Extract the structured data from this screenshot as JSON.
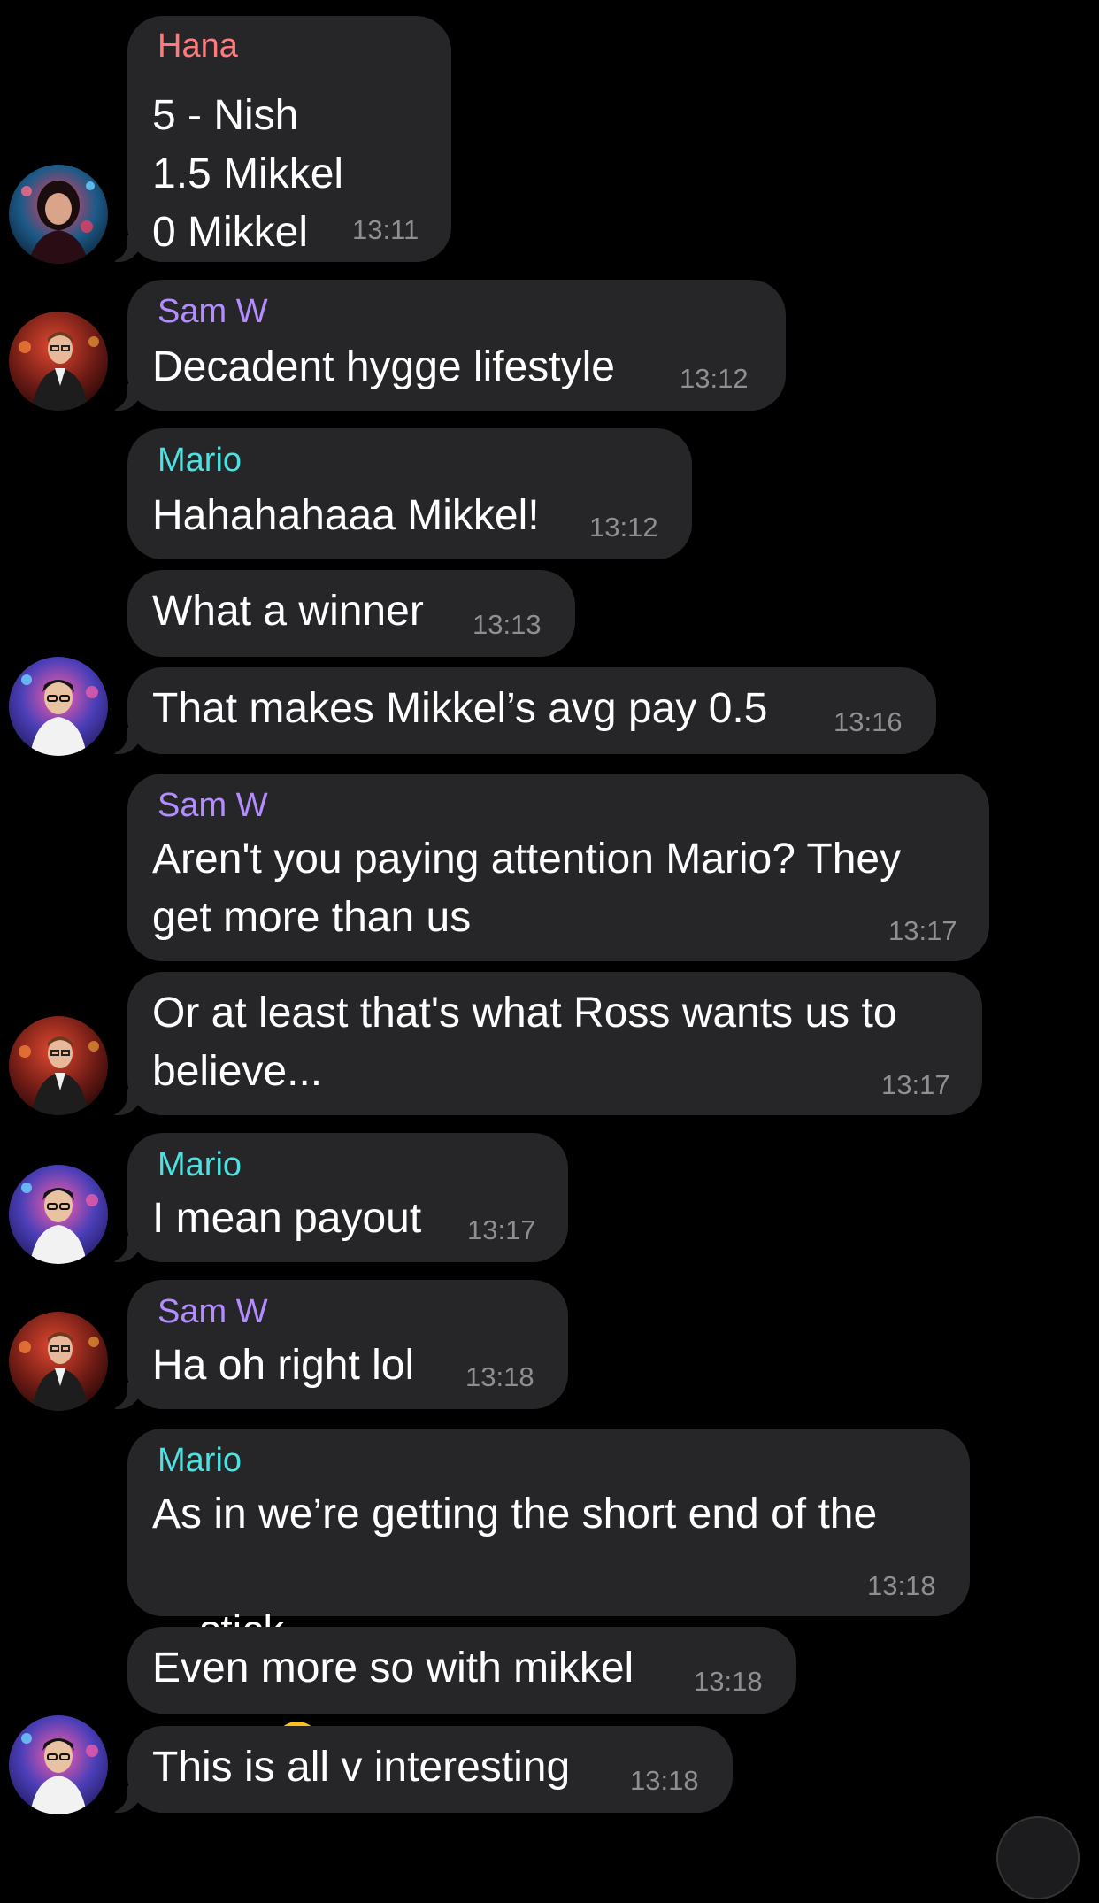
{
  "colors": {
    "background": "#000000",
    "bubble": "#262628",
    "timestamp": "#8e8e93",
    "sender_hana": "#ff7a7a",
    "sender_sam": "#b38cff",
    "sender_mario": "#4fe0e0"
  },
  "messages": [
    {
      "sender": "Hana",
      "lines": [
        "5 - Nish",
        "1.5 Mikkel",
        "0 Mikkel"
      ],
      "time": "13:11"
    },
    {
      "sender": "Sam W",
      "lines": [
        "Decadent hygge lifestyle"
      ],
      "time": "13:12"
    },
    {
      "sender": "Mario",
      "lines": [
        "Hahahahaaa Mikkel!"
      ],
      "time": "13:12"
    },
    {
      "sender": "",
      "lines": [
        "What a winner"
      ],
      "time": "13:13"
    },
    {
      "sender": "",
      "lines": [
        "That makes Mikkel’s avg pay 0.5"
      ],
      "time": "13:16"
    },
    {
      "sender": "Sam W",
      "lines": [
        "Aren't you paying attention Mario? They",
        "get more than us"
      ],
      "time": "13:17"
    },
    {
      "sender": "",
      "lines": [
        "Or at least that's what Ross wants us to",
        "believe..."
      ],
      "time": "13:17"
    },
    {
      "sender": "Mario",
      "lines": [
        "I mean payout"
      ],
      "time": "13:17"
    },
    {
      "sender": "Sam W",
      "lines": [
        "Ha oh right lol"
      ],
      "time": "13:18"
    },
    {
      "sender": "Mario",
      "lines": [
        "As in we’re getting the short end of the",
        "stick"
      ],
      "emoji": "tears-of-joy-emoji",
      "time": "13:18"
    },
    {
      "sender": "",
      "lines": [
        "Even more so with mikkel"
      ],
      "time": "13:18"
    },
    {
      "sender": "",
      "lines": [
        "This is all v interesting"
      ],
      "time": "13:18"
    }
  ],
  "avatars": [
    "hana-avatar",
    "sam-avatar",
    "mario-avatar"
  ]
}
